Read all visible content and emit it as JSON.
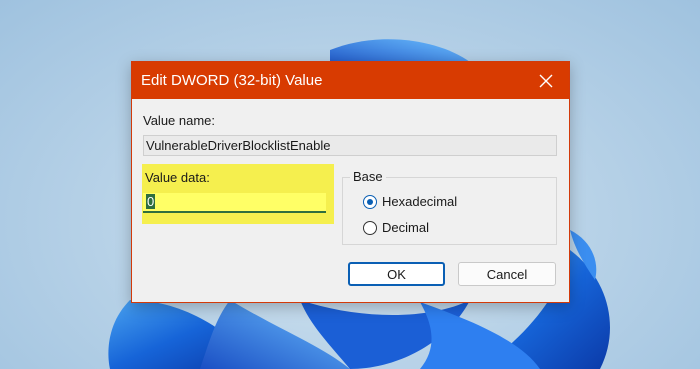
{
  "dialog": {
    "title": "Edit DWORD (32-bit) Value",
    "value_name_label": "Value name:",
    "value_name": "VulnerableDriverBlocklistEnable",
    "value_data_label": "Value data:",
    "value_data": "0",
    "base_label": "Base",
    "base_options": [
      {
        "label": "Hexadecimal",
        "selected": true
      },
      {
        "label": "Decimal",
        "selected": false
      }
    ],
    "ok_label": "OK",
    "cancel_label": "Cancel"
  },
  "colors": {
    "titlebar": "#d83b01",
    "highlight": "#f5ef4e",
    "accent": "#0a5fb4",
    "selection": "#2f6e3e"
  },
  "icons": {
    "close": "close-icon",
    "wallpaper": "windows-bloom-wallpaper"
  }
}
